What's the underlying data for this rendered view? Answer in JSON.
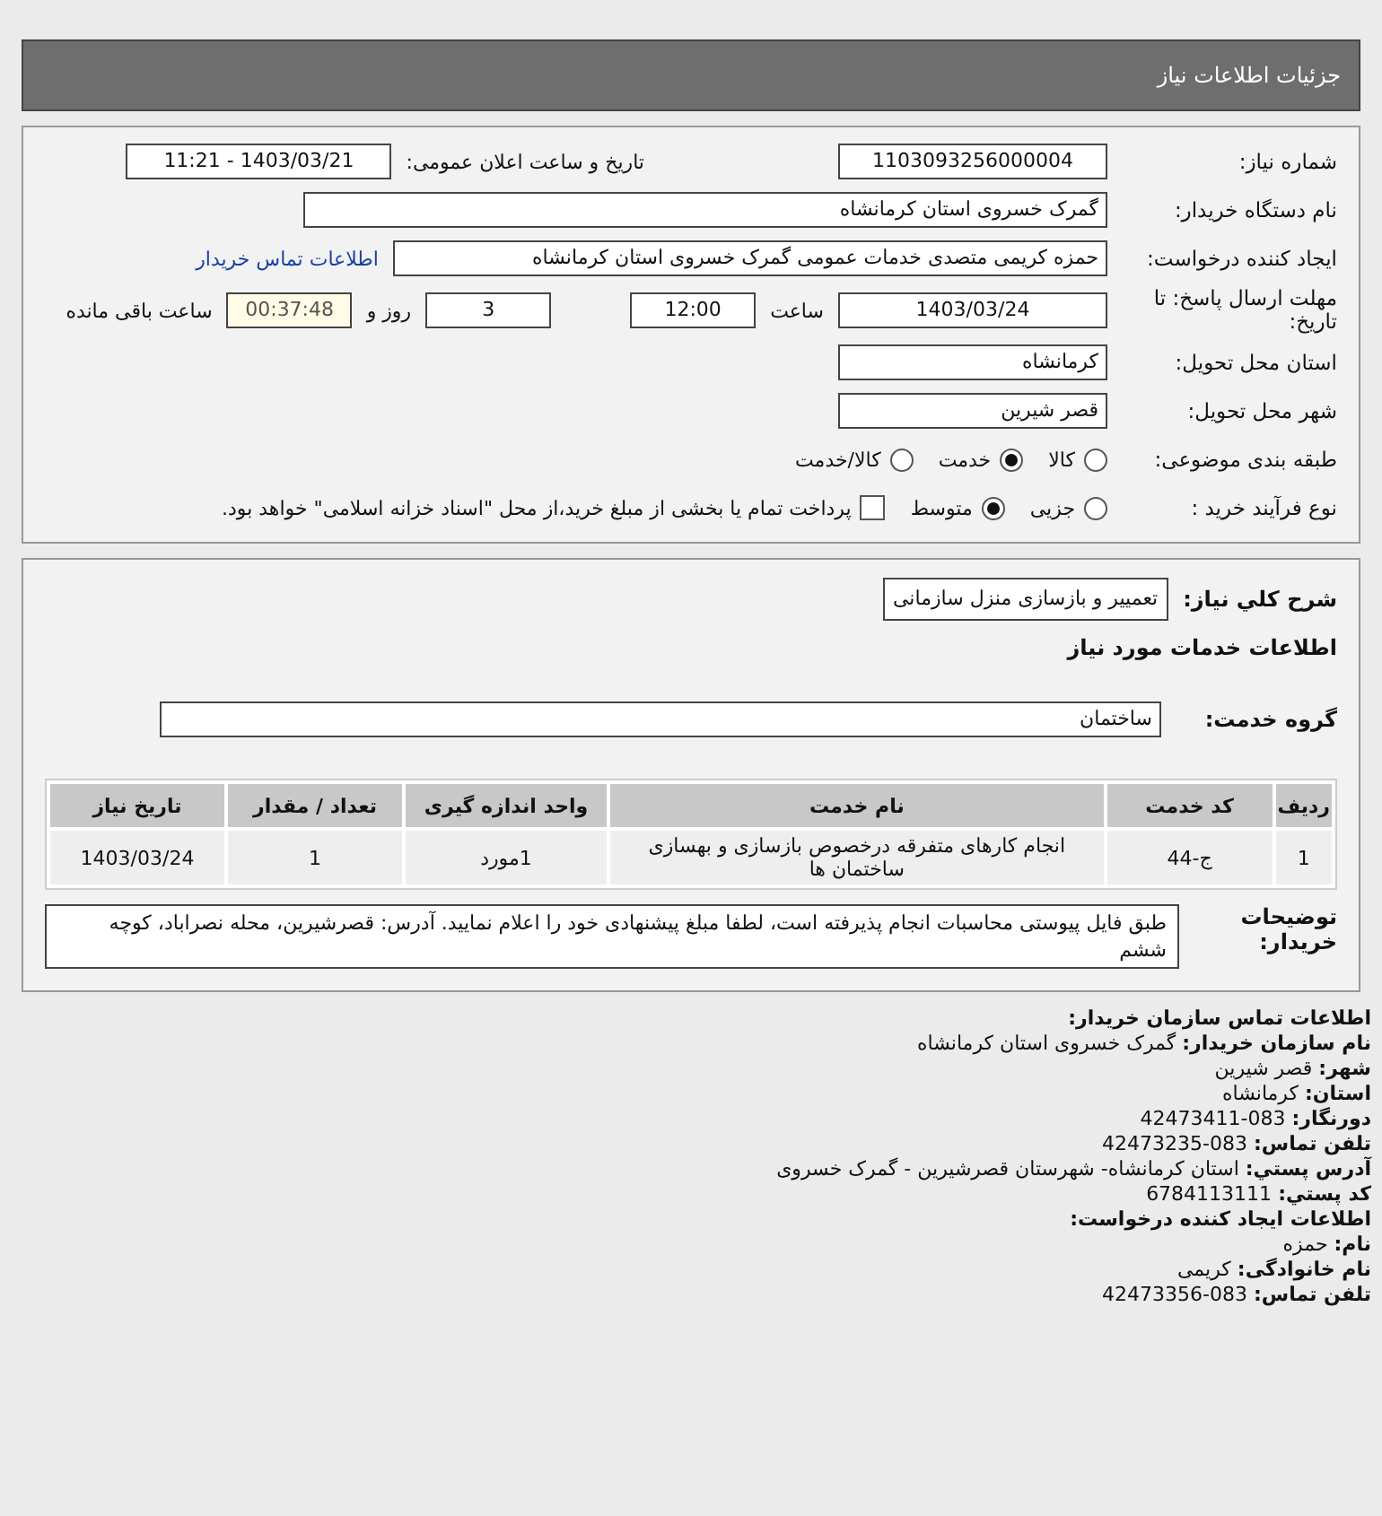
{
  "title": "جزئیات اطلاعات نیاز",
  "details": {
    "need_number": {
      "label": "شماره نیاز:",
      "value": "1103093256000004"
    },
    "announce": {
      "label": "تاریخ و ساعت اعلان عمومی:",
      "value": "1403/03/21 - 11:21"
    },
    "buyer": {
      "label": "نام دستگاه خریدار:",
      "value": "گمرک خسروی استان کرمانشاه"
    },
    "creator": {
      "label": "ایجاد کننده درخواست:",
      "value": "حمزه کریمی متصدی خدمات عمومی گمرک خسروی استان کرمانشاه",
      "link": "اطلاعات تماس خریدار"
    },
    "deadline": {
      "label": "مهلت ارسال پاسخ: تا تاریخ:",
      "date": "1403/03/24",
      "time_label": "ساعت",
      "time": "12:00",
      "days": "3",
      "days_label": "روز و",
      "remaining": "00:37:48",
      "remaining_label": "ساعت باقی مانده"
    },
    "province": {
      "label": "استان محل تحویل:",
      "value": "کرمانشاه"
    },
    "city": {
      "label": "شهر محل تحویل:",
      "value": "قصر شیرین"
    },
    "category": {
      "label": "طبقه بندی موضوعی:",
      "options": [
        {
          "label": "کالا",
          "selected": false
        },
        {
          "label": "خدمت",
          "selected": true
        },
        {
          "label": "کالا/خدمت",
          "selected": false
        }
      ]
    },
    "process": {
      "label": "نوع فرآیند خرید :",
      "options": [
        {
          "label": "جزیی",
          "selected": false
        },
        {
          "label": "متوسط",
          "selected": true
        }
      ],
      "treasury": {
        "label": "پرداخت تمام یا بخشی از مبلغ خرید،از محل \"اسناد خزانه اسلامی\" خواهد بود.",
        "checked": false
      }
    }
  },
  "services": {
    "summary": {
      "label": "شرح کلي نياز:",
      "value": "تعمییر و بازسازی منزل سازمانی"
    },
    "heading": "اطلاعات خدمات مورد نياز",
    "group": {
      "label": "گروه خدمت:",
      "value": "ساختمان"
    },
    "table": {
      "columns": [
        "ردیف",
        "کد خدمت",
        "نام خدمت",
        "واحد اندازه گیری",
        "تعداد / مقدار",
        "تاریخ نیاز"
      ],
      "rows": [
        [
          "1",
          "ج-44",
          "انجام کارهای متفرقه درخصوص بازسازی و بهسازی ساختمان ها",
          "1مورد",
          "1",
          "1403/03/24"
        ]
      ]
    },
    "notes": {
      "label": "توضیحات خریدار:",
      "value": "طبق فایل پیوستی محاسبات انجام پذیرفته است، لطفا مبلغ پیشنهادی خود را اعلام نمایید. آدرس: قصرشیرین، محله نصراباد، کوچه ششم"
    }
  },
  "contact": [
    {
      "kind": "heading",
      "text": "اطلاعات تماس سازمان خریدار:"
    },
    {
      "kind": "line",
      "text": "**نام سازمان خریدار:** گمرک خسروی استان کرمانشاه"
    },
    {
      "kind": "line",
      "text": "**شهر:** قصر شیرین"
    },
    {
      "kind": "line",
      "text": "**استان:** کرمانشاه"
    },
    {
      "kind": "line",
      "text": "**دورنگار:** 083-42473411"
    },
    {
      "kind": "line",
      "text": "**تلفن تماس:** 083-42473235"
    },
    {
      "kind": "line",
      "text": "**آدرس پستي:** استان کرمانشاه- شهرستان قصرشیرین - گمرک خسروی"
    },
    {
      "kind": "line",
      "text": "**کد پستي:** 6784113111"
    },
    {
      "kind": "heading",
      "text": "اطلاعات ایجاد کننده درخواست:"
    },
    {
      "kind": "line",
      "text": "**نام:** حمزه"
    },
    {
      "kind": "line",
      "text": "**نام خانوادگی:** کریمی"
    },
    {
      "kind": "line",
      "text": "**تلفن تماس:** 083-42473356"
    }
  ]
}
